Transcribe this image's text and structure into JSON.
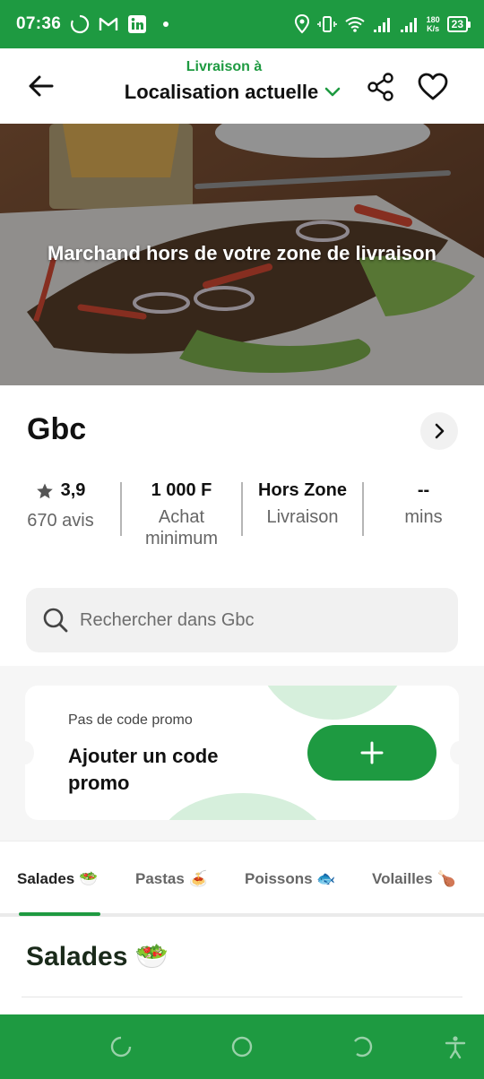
{
  "status_bar": {
    "time": "07:36",
    "net_speed_value": "180",
    "net_speed_unit": "K/s",
    "battery": "23"
  },
  "header": {
    "delivery_label": "Livraison à",
    "location": "Localisation actuelle"
  },
  "hero": {
    "message": "Marchand hors de votre zone de livraison"
  },
  "merchant": {
    "name": "Gbc",
    "stats": [
      {
        "value": "3,9",
        "label": "670 avis"
      },
      {
        "value": "1 000 F",
        "label": "Achat minimum"
      },
      {
        "value": "Hors Zone",
        "label": "Livraison"
      },
      {
        "value": "--",
        "label": "mins"
      }
    ]
  },
  "search": {
    "placeholder": "Rechercher dans Gbc"
  },
  "promo": {
    "subtitle": "Pas de code promo",
    "title": "Ajouter un code promo"
  },
  "tabs": [
    {
      "label": "Salades 🥗",
      "active": true
    },
    {
      "label": "Pastas 🍝",
      "active": false
    },
    {
      "label": "Poissons 🐟",
      "active": false
    },
    {
      "label": "Volailles 🍗",
      "active": false
    }
  ],
  "section": {
    "title": "Salades 🥗"
  },
  "colors": {
    "brand_green": "#1e9a41",
    "promo_blob": "#d6efdc"
  },
  "icons": [
    "back-arrow-icon",
    "chevron-down-icon",
    "share-icon",
    "heart-icon",
    "chevron-right-icon",
    "star-icon",
    "search-icon",
    "plus-icon"
  ]
}
